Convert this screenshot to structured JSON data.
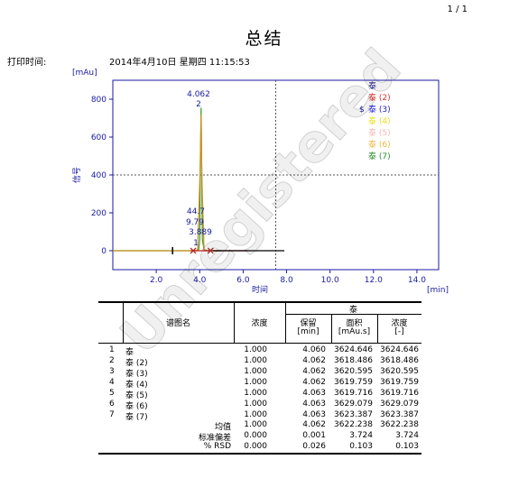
{
  "page_number": "1 / 1",
  "report_title": "总结",
  "print_time_label": "打印时间:",
  "print_time_value": "2014年4月10日 星期四  11:15:53",
  "chart_data": {
    "type": "line",
    "y_unit": "[mAu]",
    "x_unit": "[min]",
    "xlabel": "时间",
    "ylabel": "信号",
    "xlim": [
      0,
      15
    ],
    "ylim": [
      -100,
      900
    ],
    "x_ticks": [
      "2.0",
      "4.0",
      "6.0",
      "8.0",
      "10.0",
      "12.0",
      "14.0"
    ],
    "y_ticks": [
      "0",
      "200",
      "400",
      "600",
      "800"
    ],
    "crosshair": {
      "x": 7.5,
      "y": 400
    },
    "peak_labels": [
      "4.062",
      "2",
      "44.7",
      "9.79",
      "3.889",
      "1"
    ],
    "legend": [
      {
        "marker": "",
        "label": "泰",
        "color": "#1f1f8f"
      },
      {
        "marker": "",
        "label": "泰 (2)",
        "color": "#e03030"
      },
      {
        "marker": "$",
        "label": "泰 (3)",
        "color": "#2020d0"
      },
      {
        "marker": "",
        "label": "泰 (4)",
        "color": "#e8e020"
      },
      {
        "marker": "",
        "label": "泰 (5)",
        "color": "#f4b8b8"
      },
      {
        "marker": "",
        "label": "泰 (6)",
        "color": "#e8b840"
      },
      {
        "marker": "",
        "label": "泰 (7)",
        "color": "#2e8b2e"
      }
    ],
    "series": [
      {
        "name": "泰 (7)",
        "color": "#3a9a2a",
        "points": [
          [
            0,
            0
          ],
          [
            3.8,
            0
          ],
          [
            3.95,
            5
          ],
          [
            4.0,
            60
          ],
          [
            4.03,
            450
          ],
          [
            4.062,
            755
          ],
          [
            4.09,
            480
          ],
          [
            4.12,
            60
          ],
          [
            4.2,
            5
          ],
          [
            4.4,
            0
          ],
          [
            5.0,
            0
          ]
        ]
      },
      {
        "name": "泰 (6)",
        "color": "#d09020",
        "points": [
          [
            0,
            0
          ],
          [
            3.9,
            0
          ],
          [
            4.02,
            420
          ],
          [
            4.062,
            720
          ],
          [
            4.1,
            380
          ],
          [
            4.2,
            0
          ],
          [
            5.0,
            0
          ]
        ]
      },
      {
        "name": "泰 (2)",
        "color": "#cc2020",
        "points": [
          [
            3.6,
            0
          ],
          [
            6.2,
            0
          ]
        ]
      },
      {
        "name": "泰",
        "color": "#000000",
        "points": [
          [
            4.6,
            0
          ],
          [
            7.9,
            0
          ]
        ]
      }
    ],
    "markers": [
      {
        "shape": "bar",
        "x": 2.75,
        "y": 0,
        "color": "#000000"
      },
      {
        "shape": "x",
        "x": 3.7,
        "y": 0,
        "color": "#b03030"
      },
      {
        "shape": "x",
        "x": 4.5,
        "y": 0,
        "color": "#b03030"
      }
    ]
  },
  "table": {
    "compound": "泰",
    "headers": {
      "name": "谱图名",
      "conc": "浓度",
      "retention": "保留",
      "retention_unit": "[min]",
      "area": "面积",
      "area_unit": "[mAu.s]",
      "conc2": "浓度",
      "conc2_unit": "[-]"
    },
    "rows": [
      {
        "idx": "1",
        "name": "泰",
        "conc": "1.000",
        "ret": "4.060",
        "area": "3624.646",
        "conc2": "3624.646"
      },
      {
        "idx": "2",
        "name": "泰 (2)",
        "conc": "1.000",
        "ret": "4.062",
        "area": "3618.486",
        "conc2": "3618.486"
      },
      {
        "idx": "3",
        "name": "泰 (3)",
        "conc": "1.000",
        "ret": "4.062",
        "area": "3620.595",
        "conc2": "3620.595"
      },
      {
        "idx": "4",
        "name": "泰 (4)",
        "conc": "1.000",
        "ret": "4.062",
        "area": "3619.759",
        "conc2": "3619.759"
      },
      {
        "idx": "5",
        "name": "泰 (5)",
        "conc": "1.000",
        "ret": "4.063",
        "area": "3619.716",
        "conc2": "3619.716"
      },
      {
        "idx": "6",
        "name": "泰 (6)",
        "conc": "1.000",
        "ret": "4.063",
        "area": "3629.079",
        "conc2": "3629.079"
      },
      {
        "idx": "7",
        "name": "泰 (7)",
        "conc": "1.000",
        "ret": "4.063",
        "area": "3623.387",
        "conc2": "3623.387"
      }
    ],
    "stats": [
      {
        "label": "均值",
        "conc": "1.000",
        "ret": "4.062",
        "area": "3622.238",
        "conc2": "3622.238"
      },
      {
        "label": "标准偏差",
        "conc": "0.000",
        "ret": "0.001",
        "area": "3.724",
        "conc2": "3.724"
      },
      {
        "label": "% RSD",
        "conc": "0.000",
        "ret": "0.026",
        "area": "0.103",
        "conc2": "0.103"
      }
    ]
  },
  "watermark": "Unregistered"
}
